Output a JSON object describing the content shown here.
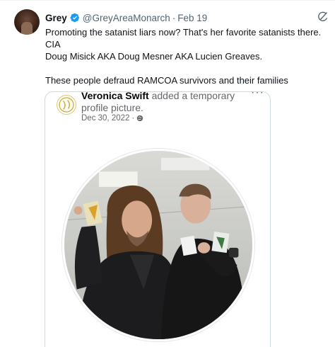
{
  "tweet": {
    "display_name": "Grey",
    "handle": "@GreyAreaMonarch",
    "separator": "·",
    "date": "Feb 19",
    "text": "Promoting the satanist liars now? That's her favorite satanists there. CIA\nDoug Misick AKA Doug Mesner AKA Lucien Greaves.\n\nThese people defraud RAMCOA survivors and their families",
    "icons": {
      "verified": "verified-badge-icon",
      "grok": "grok-icon"
    },
    "colors": {
      "verified": "#1d9bf0",
      "secondary_text": "#536471"
    }
  },
  "embed": {
    "name": "Veronica Swift",
    "action": "added a temporary",
    "action_cont": "profile picture.",
    "date": "Dec 30, 2022",
    "date_separator": "·",
    "more": "···",
    "icons": {
      "privacy": "globe-icon",
      "more": "more-options-icon"
    }
  }
}
